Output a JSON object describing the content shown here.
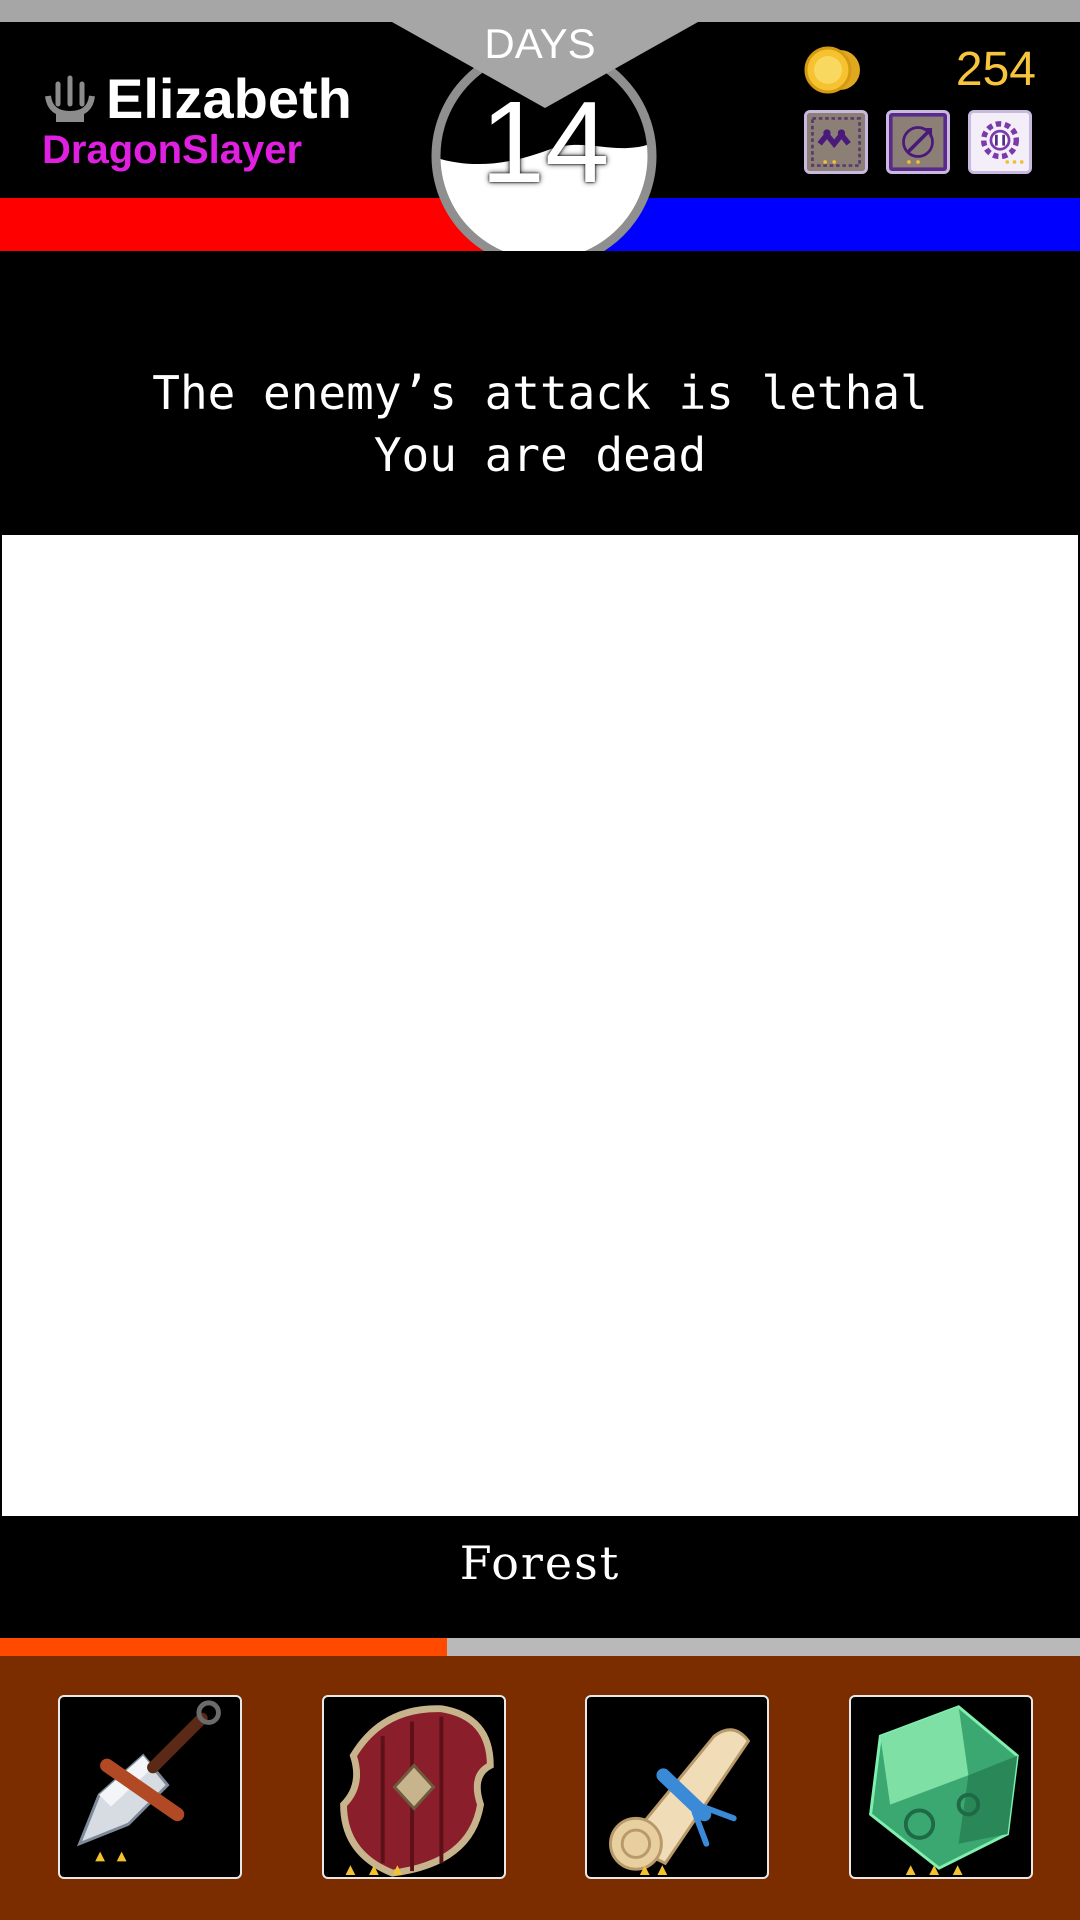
{
  "player": {
    "name": "Elizabeth",
    "title": "DragonSlayer",
    "icon": "crown-icon"
  },
  "day": {
    "label": "DAYS",
    "number": "14"
  },
  "gold": {
    "icon": "gold-coin-icon",
    "value": "254"
  },
  "skills": [
    {
      "icon": "skill-totem-icon"
    },
    {
      "icon": "skill-compass-icon"
    },
    {
      "icon": "skill-gear-icon"
    }
  ],
  "message": {
    "line1": "The enemy’s attack is lethal",
    "line2": "You are dead"
  },
  "location": {
    "name": "Forest"
  },
  "progress": {
    "fraction": 0.414
  },
  "inventory": [
    {
      "icon": "dagger-icon",
      "stars": 2
    },
    {
      "icon": "shield-icon",
      "stars": 3
    },
    {
      "icon": "scroll-icon",
      "stars": 2
    },
    {
      "icon": "green-crystal-icon",
      "stars": 3
    }
  ],
  "colors": {
    "health_bar": "#ff0000",
    "mana_bar": "#0000ff",
    "gold_text": "#f7c53c",
    "title_text": "#e020e0",
    "progress_fill": "#ff4a00",
    "inventory_bg": "#7b2d00"
  }
}
